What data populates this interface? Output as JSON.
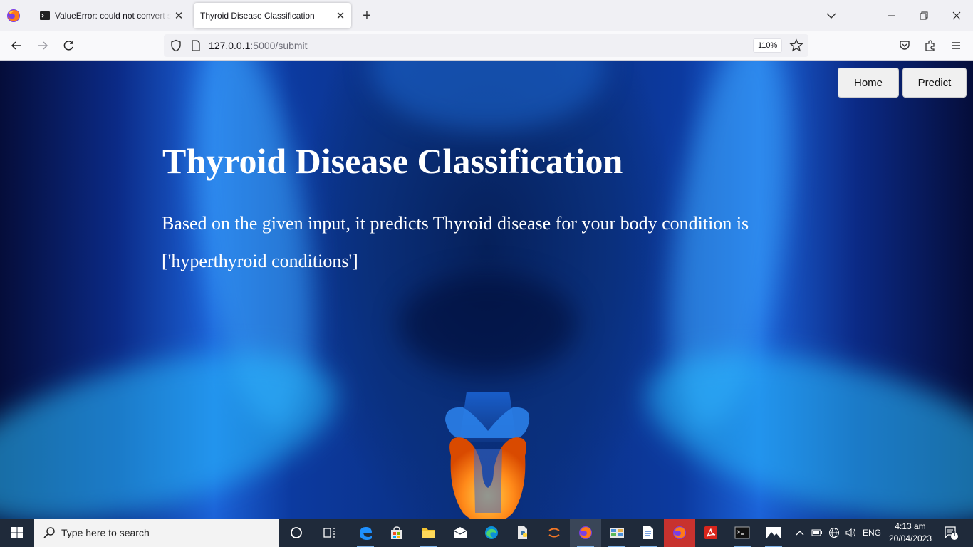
{
  "browser": {
    "tabs": [
      {
        "title": "ValueError: could not convert str",
        "active": false
      },
      {
        "title": "Thyroid Disease Classification",
        "active": true
      }
    ],
    "url": {
      "host": "127.0.0.1",
      "rest": ":5000/submit"
    },
    "zoom": "110%"
  },
  "page": {
    "nav": {
      "home_label": "Home",
      "predict_label": "Predict"
    },
    "title": "Thyroid Disease Classification",
    "result_text": "Based on the given input, it predicts Thyroid disease for your body condition is",
    "result_value": "['hyperthyroid conditions']"
  },
  "taskbar": {
    "search_placeholder": "Type here to search",
    "language": "ENG",
    "time": "4:13 am",
    "date": "20/04/2023",
    "notification_count": "1"
  },
  "colors": {
    "accent": "#7fb3e8",
    "page_text": "#ffffff",
    "taskbar": "#1f2a3a"
  }
}
